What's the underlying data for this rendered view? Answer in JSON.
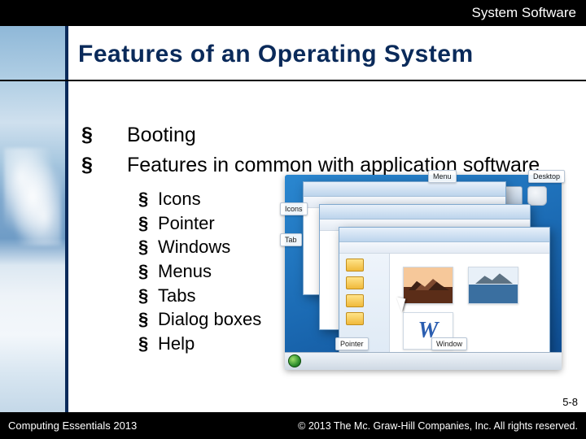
{
  "chapter_title": "System Software",
  "heading": "Features of an Operating System",
  "bullets": {
    "main_0": "Booting",
    "main_1": "Features in common with application software",
    "sub_0": "Icons",
    "sub_1": "Pointer",
    "sub_2": "Windows",
    "sub_3": "Menus",
    "sub_4": "Tabs",
    "sub_5": "Dialog boxes",
    "sub_6": "Help"
  },
  "labels": {
    "menu": "Menu",
    "desktop": "Desktop",
    "icons": "Icons",
    "tab": "Tab",
    "pointer": "Pointer",
    "window": "Window"
  },
  "page_number": "5-8",
  "footer": {
    "left": "Computing Essentials 2013",
    "right": "© 2013 The Mc. Graw-Hill Companies, Inc. All rights reserved."
  }
}
